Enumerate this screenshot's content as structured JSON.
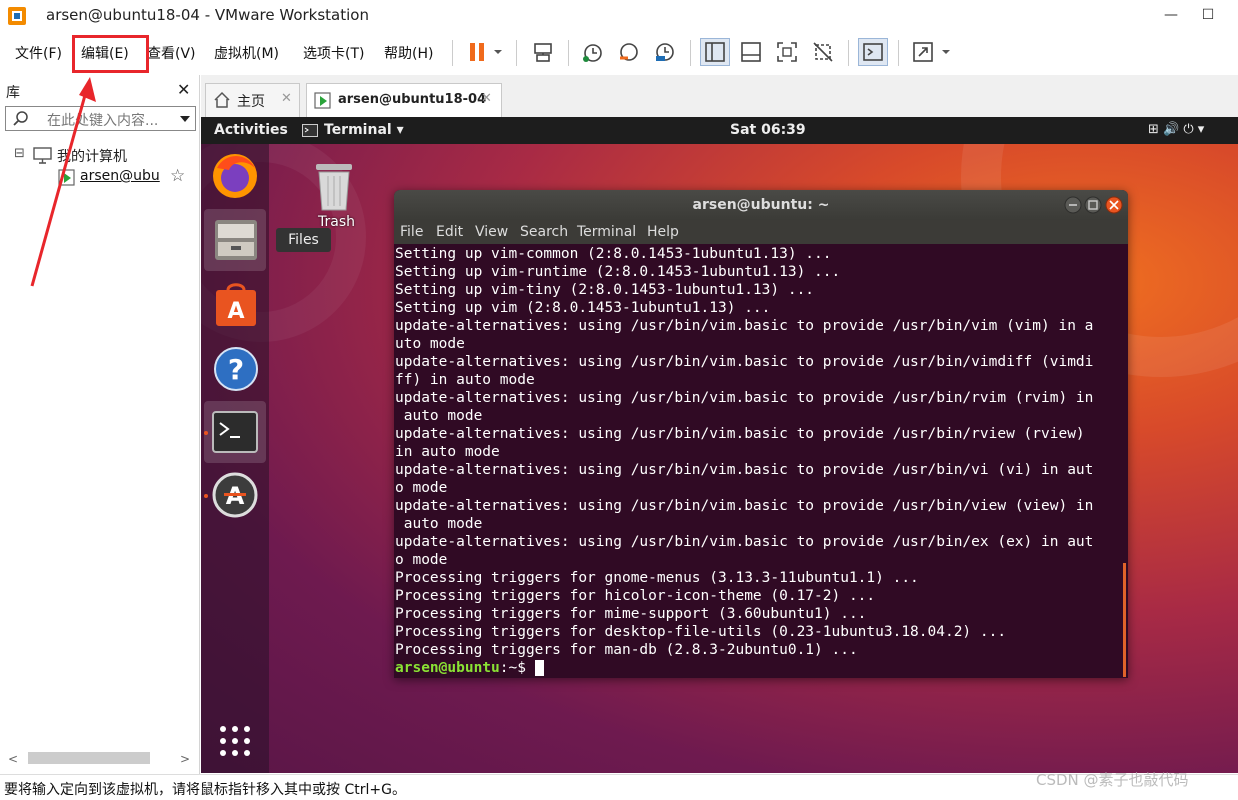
{
  "window": {
    "title": "arsen@ubuntu18-04 - VMware Workstation",
    "min": "—",
    "max": "☐",
    "close": "✕"
  },
  "menu": [
    "文件(F)",
    "编辑(E)",
    "查看(V)",
    "虚拟机(M)",
    "选项卡(T)",
    "帮助(H)"
  ],
  "library": {
    "title": "库",
    "close": "✕",
    "search_placeholder": "在此处键入内容...",
    "root": "我的计算机",
    "vm": "arsen@ubu",
    "collapse": "⊟",
    "star": "☆"
  },
  "tabs": [
    {
      "label": "主页",
      "close": "✕"
    },
    {
      "label": "arsen@ubuntu18-04",
      "close": "✕"
    }
  ],
  "ubuntu": {
    "activities": "Activities",
    "app_menu": "Terminal ▾",
    "clock": "Sat 06:39",
    "tray": "⊞ 🔊 ⏻ ▾",
    "files_tooltip": "Files",
    "trash_label": "Trash"
  },
  "terminal": {
    "title": "arsen@ubuntu: ~",
    "menu": [
      "File",
      "Edit",
      "View",
      "Search",
      "Terminal",
      "Help"
    ],
    "lines": [
      "Setting up vim-common (2:8.0.1453-1ubuntu1.13) ...",
      "Setting up vim-runtime (2:8.0.1453-1ubuntu1.13) ...",
      "Setting up vim-tiny (2:8.0.1453-1ubuntu1.13) ...",
      "Setting up vim (2:8.0.1453-1ubuntu1.13) ...",
      "update-alternatives: using /usr/bin/vim.basic to provide /usr/bin/vim (vim) in a",
      "uto mode",
      "update-alternatives: using /usr/bin/vim.basic to provide /usr/bin/vimdiff (vimdi",
      "ff) in auto mode",
      "update-alternatives: using /usr/bin/vim.basic to provide /usr/bin/rvim (rvim) in",
      " auto mode",
      "update-alternatives: using /usr/bin/vim.basic to provide /usr/bin/rview (rview)",
      "in auto mode",
      "update-alternatives: using /usr/bin/vim.basic to provide /usr/bin/vi (vi) in aut",
      "o mode",
      "update-alternatives: using /usr/bin/vim.basic to provide /usr/bin/view (view) in",
      " auto mode",
      "update-alternatives: using /usr/bin/vim.basic to provide /usr/bin/ex (ex) in aut",
      "o mode",
      "Processing triggers for gnome-menus (3.13.3-11ubuntu1.1) ...",
      "Processing triggers for hicolor-icon-theme (0.17-2) ...",
      "Processing triggers for mime-support (3.60ubuntu1) ...",
      "Processing triggers for desktop-file-utils (0.23-1ubuntu3.18.04.2) ...",
      "Processing triggers for man-db (2.8.3-2ubuntu0.1) ..."
    ],
    "prompt_user": "arsen@ubuntu",
    "prompt_rest": ":~$ "
  },
  "status": "要将输入定向到该虚拟机，请将鼠标指针移入其中或按 Ctrl+G。",
  "watermark": "CSDN @素子也敲代码",
  "colors": {
    "highlight": "#e8262b",
    "terminal_bg": "#300a24",
    "prompt": "#8ae234",
    "accent": "#e95420"
  }
}
